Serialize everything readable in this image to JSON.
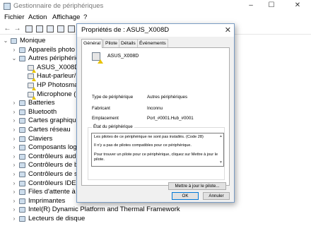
{
  "main_window": {
    "title": "Gestionnaire de périphériques",
    "controls": {
      "minimize": "–",
      "maximize": "☐",
      "close": "✕"
    },
    "menu": [
      "Fichier",
      "Action",
      "Affichage",
      "?"
    ],
    "tree": [
      {
        "label": "Monique",
        "level": 0,
        "expander": "⌄"
      },
      {
        "label": "Appareils photo",
        "level": 1,
        "expander": "›"
      },
      {
        "label": "Autres périphériques",
        "level": 1,
        "expander": "⌄"
      },
      {
        "label": "ASUS_X008D",
        "level": 2,
        "expander": "",
        "warn": true
      },
      {
        "label": "Haut-parleur/Écouteurs",
        "level": 2,
        "expander": "",
        "warn": true
      },
      {
        "label": "HP Photosmart",
        "level": 2,
        "expander": "",
        "warn": true
      },
      {
        "label": "Microphone (Realtek)",
        "level": 2,
        "expander": "",
        "warn": true
      },
      {
        "label": "Batteries",
        "level": 1,
        "expander": "›"
      },
      {
        "label": "Bluetooth",
        "level": 1,
        "expander": "›"
      },
      {
        "label": "Cartes graphiques",
        "level": 1,
        "expander": "›"
      },
      {
        "label": "Cartes réseau",
        "level": 1,
        "expander": "›"
      },
      {
        "label": "Claviers",
        "level": 1,
        "expander": "›"
      },
      {
        "label": "Composants logiciels",
        "level": 1,
        "expander": "›"
      },
      {
        "label": "Contrôleurs audio, vidéo et jeu",
        "level": 1,
        "expander": "›"
      },
      {
        "label": "Contrôleurs de bus USB",
        "level": 1,
        "expander": "›"
      },
      {
        "label": "Contrôleurs de stockage",
        "level": 1,
        "expander": "›"
      },
      {
        "label": "Contrôleurs IDE ATA/ATAPI",
        "level": 1,
        "expander": "›"
      },
      {
        "label": "Files d'attente à l'impression",
        "level": 1,
        "expander": "›"
      },
      {
        "label": "Imprimantes",
        "level": 1,
        "expander": "›"
      },
      {
        "label": "Intel(R) Dynamic Platform and Thermal Framework",
        "level": 1,
        "expander": "›"
      },
      {
        "label": "Lecteurs de disque",
        "level": 1,
        "expander": "›"
      }
    ]
  },
  "dialog": {
    "title": "Propriétés de : ASUS_X008D",
    "close": "✕",
    "tabs": [
      "Général",
      "Pilote",
      "Détails",
      "Événements"
    ],
    "active_tab": "Général",
    "device_name": "ASUS_X008D",
    "properties": [
      {
        "label": "Type de périphérique",
        "value": "Autres périphériques"
      },
      {
        "label": "Fabricant",
        "value": "Inconnu"
      },
      {
        "label": "Emplacement",
        "value": "Port_#0001.Hub_#0001"
      }
    ],
    "status_group_label": "État du périphérique",
    "status_lines": [
      "Les pilotes de ce périphérique ne sont pas installés. (Code 28)",
      "Il n'y a pas de pilotes compatibles pour ce périphérique.",
      "Pour trouver un pilote pour ce périphérique, cliquez sur Mettre à jour le pilote."
    ],
    "update_driver_button": "Mettre à jour le pilote...",
    "ok_button": "OK",
    "cancel_button": "Annuler"
  }
}
